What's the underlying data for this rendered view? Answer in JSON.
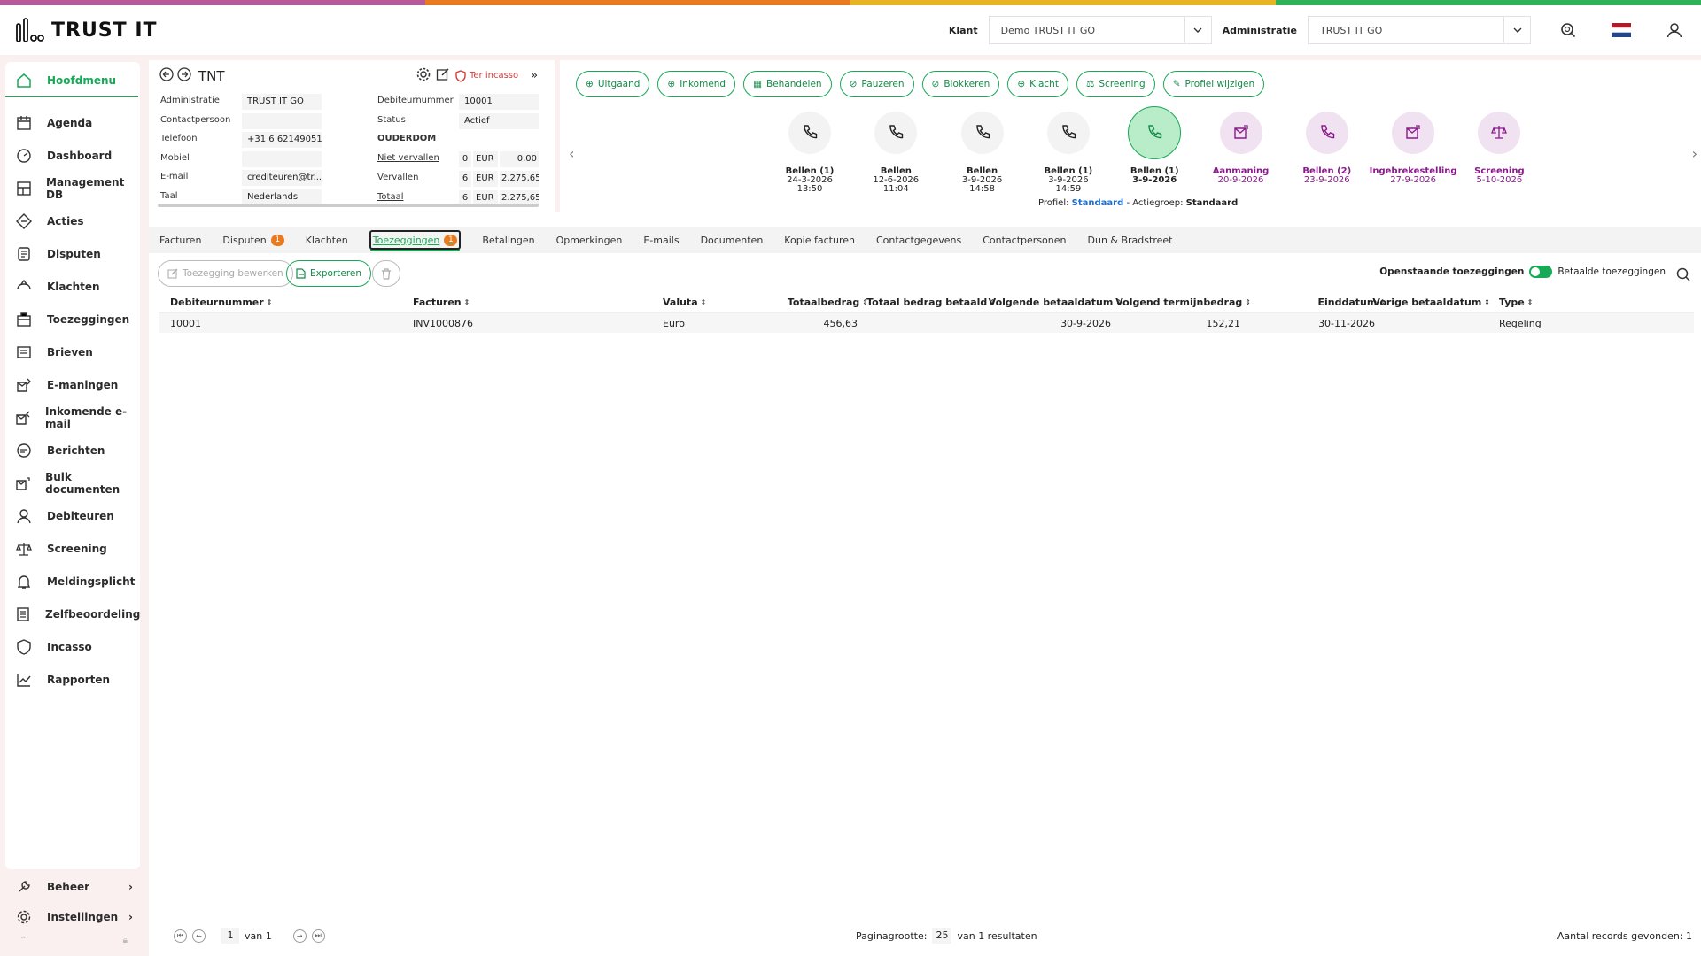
{
  "colors": {
    "accent": "#18a957",
    "purple": "#8a1a8c",
    "badge": "#e97a1f",
    "danger": "#d63a3a",
    "stripe": [
      "#b85a9a",
      "#e97a1f",
      "#e8b423",
      "#2fb356"
    ]
  },
  "topbar": {
    "logo": "TRUST IT",
    "klant_label": "Klant",
    "klant_value": "Demo TRUST IT GO",
    "admin_label": "Administratie",
    "admin_value": "TRUST IT GO"
  },
  "sidebar": {
    "items": [
      {
        "label": "Hoofdmenu",
        "icon": "home-icon"
      },
      {
        "label": "Agenda",
        "icon": "calendar-icon"
      },
      {
        "label": "Dashboard",
        "icon": "dashboard-icon"
      },
      {
        "label": "Management DB",
        "icon": "management-icon"
      },
      {
        "label": "Acties",
        "icon": "actions-icon"
      },
      {
        "label": "Disputen",
        "icon": "dispute-icon"
      },
      {
        "label": "Klachten",
        "icon": "complaint-icon"
      },
      {
        "label": "Toezeggingen",
        "icon": "promise-icon"
      },
      {
        "label": "Brieven",
        "icon": "letter-icon"
      },
      {
        "label": "E-maningen",
        "icon": "email-reminder-icon"
      },
      {
        "label": "Inkomende e-mail",
        "icon": "incoming-mail-icon"
      },
      {
        "label": "Berichten",
        "icon": "message-icon"
      },
      {
        "label": "Bulk documenten",
        "icon": "bulk-docs-icon"
      },
      {
        "label": "Debiteuren",
        "icon": "user-icon"
      },
      {
        "label": "Screening",
        "icon": "scale-icon"
      },
      {
        "label": "Meldingsplicht",
        "icon": "bell-icon"
      },
      {
        "label": "Zelfbeoordeling",
        "icon": "assessment-icon"
      },
      {
        "label": "Incasso",
        "icon": "shield-icon"
      },
      {
        "label": "Rapporten",
        "icon": "chart-icon"
      }
    ],
    "beheer": "Beheer",
    "instellingen": "Instellingen"
  },
  "debtor": {
    "name": "TNT",
    "incasso": "Ter incasso",
    "left": [
      [
        "Administratie",
        "TRUST IT GO"
      ],
      [
        "Contactpersoon",
        ""
      ],
      [
        "Telefoon",
        "+31 6 62149051"
      ],
      [
        "Mobiel",
        ""
      ],
      [
        "E-mail",
        "crediteuren@tr..."
      ],
      [
        "Taal",
        "Nederlands"
      ]
    ],
    "deb_label": "Debiteurnummer",
    "deb_value": "10001",
    "status_label": "Status",
    "status_value": "Actief",
    "ouderdom": "OUDERDOM",
    "aging": [
      [
        "Niet vervallen",
        "0",
        "EUR",
        "0,00"
      ],
      [
        "Vervallen",
        "6",
        "EUR",
        "2.275,65"
      ],
      [
        "Totaal",
        "6",
        "EUR",
        "2.275,65"
      ]
    ]
  },
  "actions": {
    "buttons": [
      "Uitgaand",
      "Inkomend",
      "Behandelen",
      "Pauzeren",
      "Blokkeren",
      "Klacht",
      "Screening",
      "Profiel wijzigen"
    ]
  },
  "timeline": [
    {
      "name": "Bellen (1)",
      "date": "24-3-2026",
      "time": "13:50",
      "kind": "grey"
    },
    {
      "name": "Bellen",
      "date": "12-6-2026",
      "time": "11:04",
      "kind": "grey"
    },
    {
      "name": "Bellen",
      "date": "3-9-2026",
      "time": "14:58",
      "kind": "grey"
    },
    {
      "name": "Bellen (1)",
      "date": "3-9-2026",
      "time": "14:59",
      "kind": "grey"
    },
    {
      "name": "Bellen (1)",
      "date": "3-9-2026",
      "time": "",
      "kind": "active"
    },
    {
      "name": "Aanmaning",
      "date": "20-9-2026",
      "time": "",
      "kind": "purple"
    },
    {
      "name": "Bellen (2)",
      "date": "23-9-2026",
      "time": "",
      "kind": "purple"
    },
    {
      "name": "Ingebrekestelling",
      "date": "27-9-2026",
      "time": "",
      "kind": "purple"
    },
    {
      "name": "Screening",
      "date": "5-10-2026",
      "time": "",
      "kind": "purple"
    }
  ],
  "profile": {
    "profiel_label": "Profiel:",
    "profiel": "Standaard",
    "sep": "- Actiegroep:",
    "actiegroep": "Standaard"
  },
  "tabs": [
    {
      "label": "Facturen",
      "badge": ""
    },
    {
      "label": "Disputen",
      "badge": "1"
    },
    {
      "label": "Klachten",
      "badge": ""
    },
    {
      "label": "Toezeggingen",
      "badge": "1",
      "active": true
    },
    {
      "label": "Betalingen",
      "badge": ""
    },
    {
      "label": "Opmerkingen",
      "badge": ""
    },
    {
      "label": "E-mails",
      "badge": ""
    },
    {
      "label": "Documenten",
      "badge": ""
    },
    {
      "label": "Kopie facturen",
      "badge": ""
    },
    {
      "label": "Contactgegevens",
      "badge": ""
    },
    {
      "label": "Contactpersonen",
      "badge": ""
    },
    {
      "label": "Dun & Bradstreet",
      "badge": ""
    }
  ],
  "toolbar": {
    "edit": "Toezegging bewerken",
    "export": "Exporteren",
    "open": "Openstaande toezeggingen",
    "paid": "Betaalde toezeggingen"
  },
  "table": {
    "columns": [
      "Debiteurnummer",
      "Facturen",
      "Valuta",
      "Totaalbedrag",
      "Totaal bedrag betaald",
      "Volgende betaaldatum",
      "Volgend termijnbedrag",
      "Einddatum",
      "Vorige betaaldatum",
      "Type"
    ],
    "rows": [
      [
        "10001",
        "INV1000876",
        "Euro",
        "456,63",
        "",
        "30-9-2026",
        "152,21",
        "30-11-2026",
        "",
        "Regeling"
      ]
    ]
  },
  "footer": {
    "page": "1",
    "of": "van 1",
    "size_label": "Paginagrootte:",
    "size": "25",
    "results": "van 1 resultaten",
    "records": "Aantal records gevonden: 1"
  }
}
